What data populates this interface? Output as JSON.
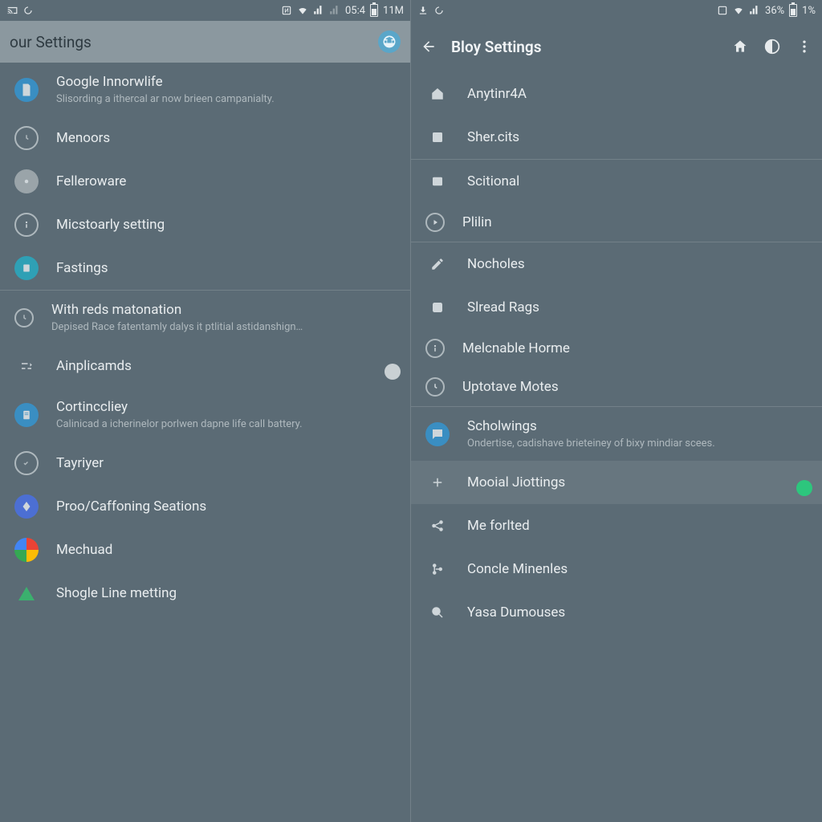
{
  "left": {
    "status": {
      "time": "05:4",
      "extra": "11M"
    },
    "appbar": {
      "title": "our Settings"
    },
    "items": [
      {
        "icon": "document-icon",
        "bg": "bg-blue",
        "title": "Google Innorwlife",
        "sub": "Slisording a ithercal ar now brieen campanialty."
      },
      {
        "icon": "clock-icon",
        "bg": "outline",
        "title": "Menoors"
      },
      {
        "icon": "dot-icon",
        "bg": "bg-grey",
        "title": "Felleroware"
      },
      {
        "icon": "info-icon",
        "bg": "outline",
        "title": "Micstoarly setting"
      },
      {
        "icon": "sheet-icon",
        "bg": "bg-teal",
        "title": "Fastings"
      }
    ],
    "items2": [
      {
        "icon": "clock-icon",
        "bg": "outline",
        "title": "With reds matonation",
        "sub": "Depised Race fatentamly dalys it ptlitial astidanshign…"
      },
      {
        "icon": "tune-icon",
        "bg": "",
        "title": "Ainplicamds",
        "toggle": "off"
      },
      {
        "icon": "doc2-icon",
        "bg": "bg-blue",
        "title": "Cortinccliey",
        "sub": "Calinicad a icherinelor porlwen dapne life call battery."
      },
      {
        "icon": "circle-icon",
        "bg": "outline",
        "title": "Tayriyer"
      },
      {
        "icon": "diamond-icon",
        "bg": "bg-indigo",
        "title": "Proo/Caffoning Seations"
      },
      {
        "icon": "multi-icon",
        "bg": "bg-multi",
        "title": "Mechuad"
      },
      {
        "icon": "drive-icon",
        "bg": "",
        "title": "Shogle Line metting"
      }
    ]
  },
  "right": {
    "status": {
      "time": "36%",
      "extra": "1%"
    },
    "appbar": {
      "title": "Bloy Settings"
    },
    "group1": [
      {
        "icon": "home-outline-icon",
        "title": "Anytinr4A"
      },
      {
        "icon": "list-icon",
        "title": "Sher.cits"
      }
    ],
    "group2": [
      {
        "icon": "square-icon",
        "title": "Scitional"
      },
      {
        "icon": "play-circle-icon",
        "title": "Plilin"
      }
    ],
    "group3": [
      {
        "icon": "pencil-icon",
        "title": "Nocholes"
      },
      {
        "icon": "dot-square-icon",
        "title": "Slread Rags"
      },
      {
        "icon": "info-icon",
        "title": "Melcnable Horme"
      },
      {
        "icon": "clock-icon",
        "title": "Uptotave Motes"
      }
    ],
    "group4": [
      {
        "icon": "chat-icon",
        "bg": "bg-blue",
        "title": "Scholwings",
        "sub": "Ondertise, cadishave brieteiney of bixy mindiar scees."
      },
      {
        "icon": "plus-icon",
        "title": "Mooial Jiottings",
        "toggle": "on",
        "highlight": true
      },
      {
        "icon": "share-icon",
        "title": "Me forlted"
      },
      {
        "icon": "branch-icon",
        "title": "Concle Minenles"
      },
      {
        "icon": "search-icon",
        "title": "Yasa Dumouses"
      }
    ]
  }
}
